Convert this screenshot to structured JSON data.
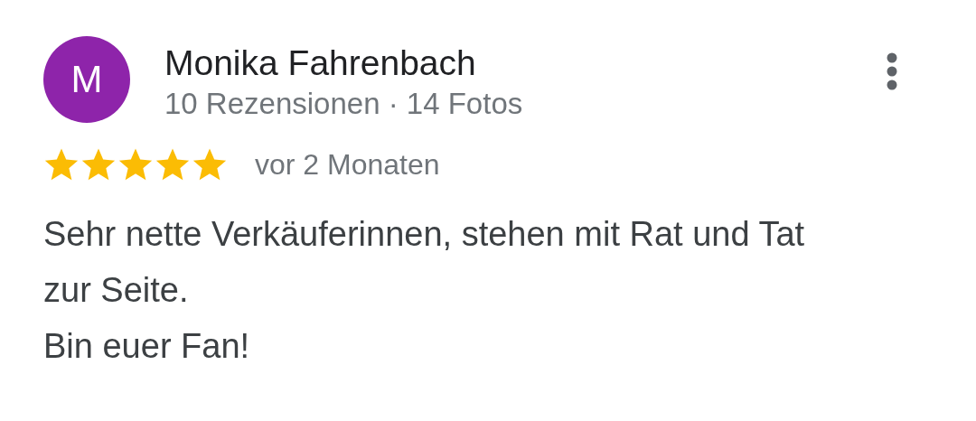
{
  "review": {
    "author": {
      "initial": "M",
      "name": "Monika Fahrenbach",
      "color": "#8e24aa"
    },
    "meta": "10 Rezensionen · 14 Fotos",
    "stars": 5,
    "time": "vor 2 Monaten",
    "paragraphs": [
      "Sehr nette Verkäuferinnen, stehen mit Rat und Tat zur Seite.",
      "Bin euer Fan!"
    ]
  }
}
